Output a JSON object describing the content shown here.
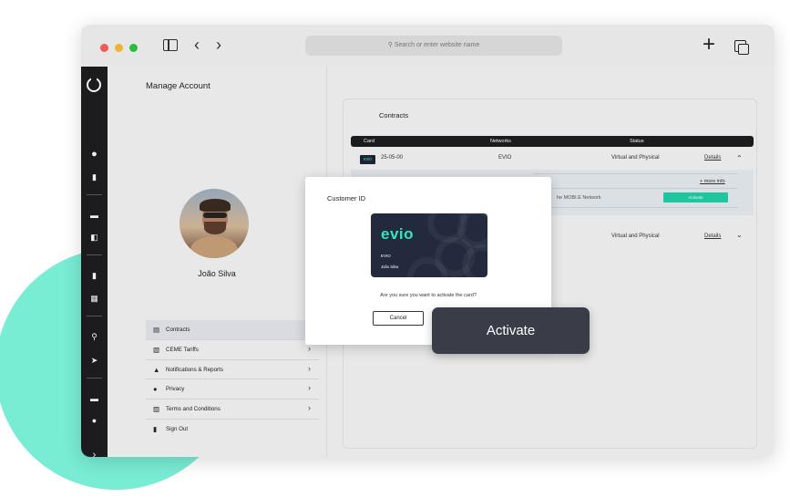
{
  "browser": {
    "address_placeholder": "Search or enter website name",
    "back_glyph": "‹",
    "forward_glyph": "›",
    "new_tab_glyph": "+",
    "traffic_light_colors": [
      "#ff5f57",
      "#febc2e",
      "#28c840"
    ]
  },
  "sidebar": {
    "expand_glyph": "›",
    "icons": [
      "evio-logo-icon",
      "user-icon",
      "chart-icon",
      "car-icon",
      "charger-icon",
      "battery-icon",
      "calendar-icon",
      "route-icon",
      "navigation-icon",
      "card-icon",
      "badge-icon",
      "chevron-right-icon"
    ]
  },
  "account": {
    "title": "Manage Account",
    "user_name": "João Silva",
    "menu": [
      {
        "label": "Contracts",
        "icon": "document-icon",
        "chevron": "›"
      },
      {
        "label": "CEME Tariffs",
        "icon": "tariffs-icon",
        "chevron": "›"
      },
      {
        "label": "Notifications & Reports",
        "icon": "bell-icon",
        "chevron": "›"
      },
      {
        "label": "Privacy",
        "icon": "lock-icon",
        "chevron": "›"
      },
      {
        "label": "Terms and Conditions",
        "icon": "terms-icon",
        "chevron": "›"
      },
      {
        "label": "Sign Out",
        "icon": "door-icon"
      }
    ]
  },
  "contracts": {
    "title": "Contracts",
    "headers": {
      "card": "Card",
      "networks": "Networks",
      "status": "Status"
    },
    "rows": [
      {
        "thumb": "evio",
        "date": "25-05-00",
        "network": "EVIO",
        "status": "Virtual and Physical",
        "details": "Details",
        "toggle": "⌃"
      },
      {
        "status": "Virtual and Physical",
        "details": "Details",
        "toggle": "⌄"
      }
    ],
    "expanded": {
      "more_info": "+ more info",
      "network_text": "he MOBI.E Network",
      "activate_label": "Activate"
    }
  },
  "modal": {
    "title": "Customer ID",
    "card_logo": "evio",
    "card_brand": "EVIO",
    "card_holder": "João Silva",
    "question": "Are you sure you want to activate the card?",
    "cancel_label": "Cancel",
    "activate_label": "Activate"
  },
  "colors": {
    "accent": "#1ed1a8",
    "blob": "#79ecd4",
    "sidebar": "#1c1c1f",
    "card": "#232a3d"
  }
}
